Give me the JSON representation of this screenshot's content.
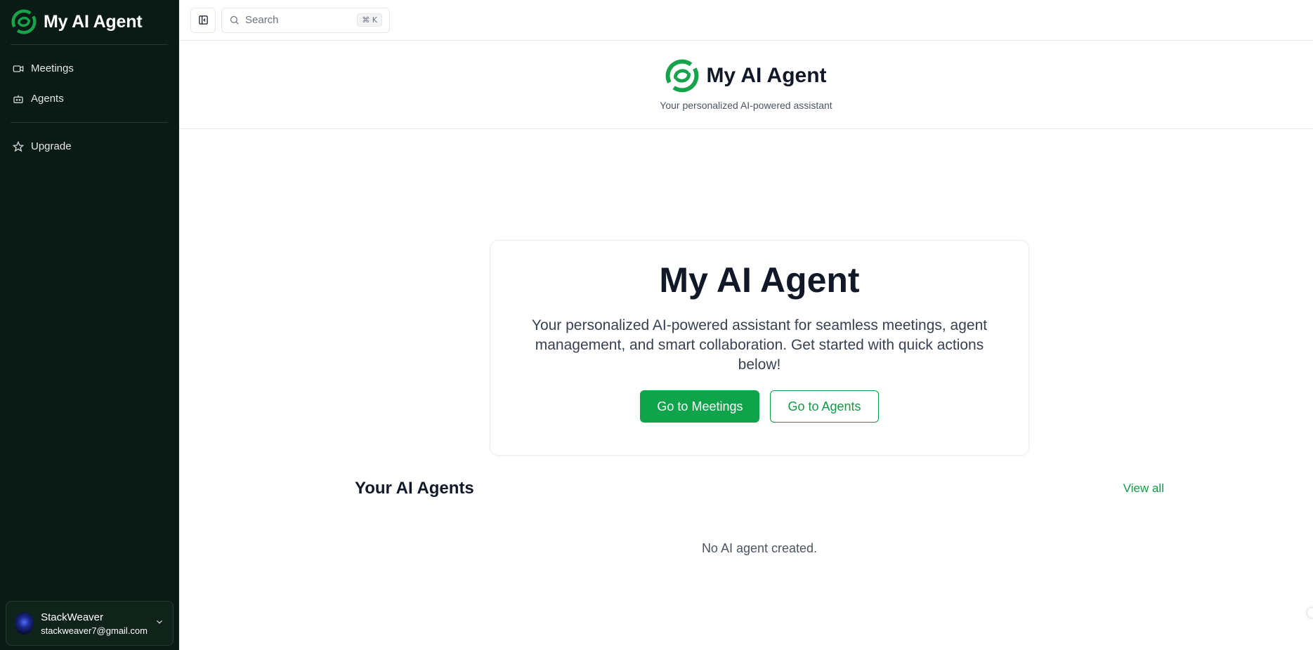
{
  "app": {
    "title": "My AI Agent"
  },
  "sidebar": {
    "brand": "My AI Agent",
    "items": [
      {
        "label": "Meetings",
        "icon": "video-icon"
      },
      {
        "label": "Agents",
        "icon": "bot-icon"
      }
    ],
    "secondary_items": [
      {
        "label": "Upgrade",
        "icon": "star-icon"
      }
    ],
    "user": {
      "name": "StackWeaver",
      "email": "stackweaver7@gmail.com"
    }
  },
  "topbar": {
    "search_placeholder": "Search",
    "shortcut": "⌘ K"
  },
  "header": {
    "title": "My AI Agent",
    "subtitle": "Your personalized AI-powered assistant"
  },
  "hero": {
    "title": "My AI Agent",
    "description": "Your personalized AI-powered assistant for seamless meetings, agent management, and smart collaboration. Get started with quick actions below!",
    "primary_button": "Go to Meetings",
    "secondary_button": "Go to Agents"
  },
  "agents_section": {
    "title": "Your AI Agents",
    "view_all": "View all",
    "empty_message": "No AI agent created."
  },
  "colors": {
    "sidebar_bg": "#0a1a14",
    "accent": "#0fa34a"
  }
}
